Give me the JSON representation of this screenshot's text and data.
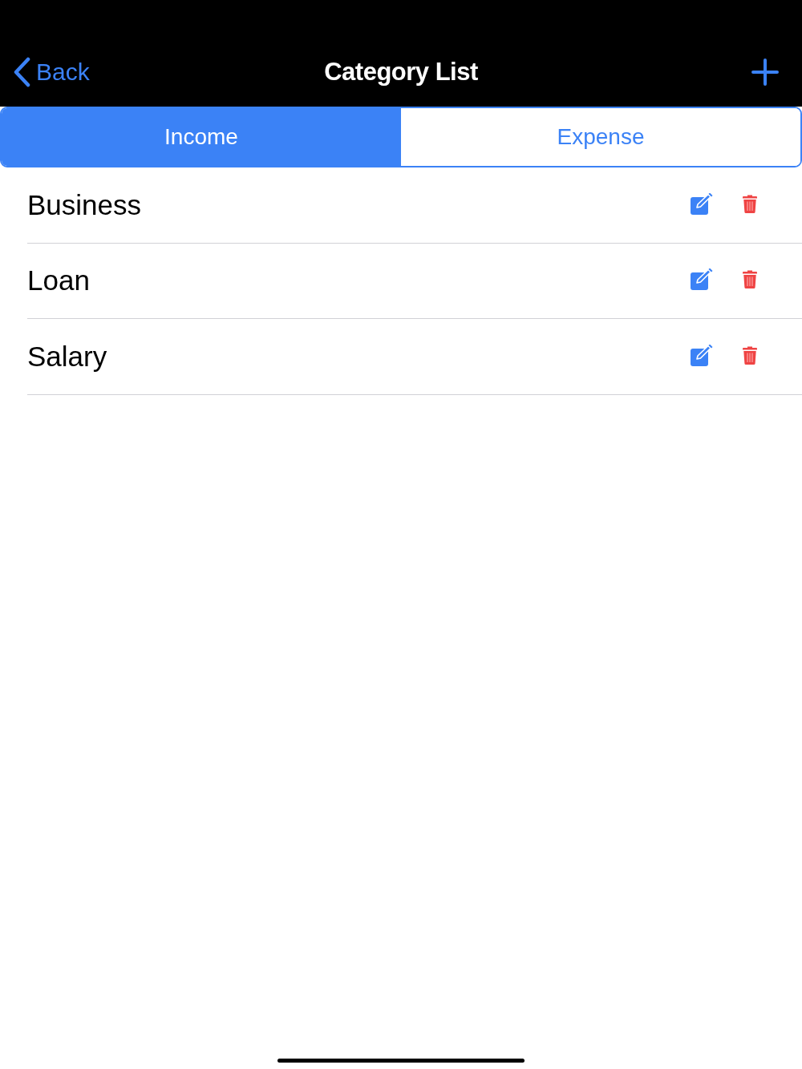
{
  "nav": {
    "back_label": "Back",
    "title": "Category List"
  },
  "segments": [
    {
      "label": "Income",
      "selected": true
    },
    {
      "label": "Expense",
      "selected": false
    }
  ],
  "categories": [
    {
      "name": "Business"
    },
    {
      "name": "Loan"
    },
    {
      "name": "Salary"
    }
  ]
}
